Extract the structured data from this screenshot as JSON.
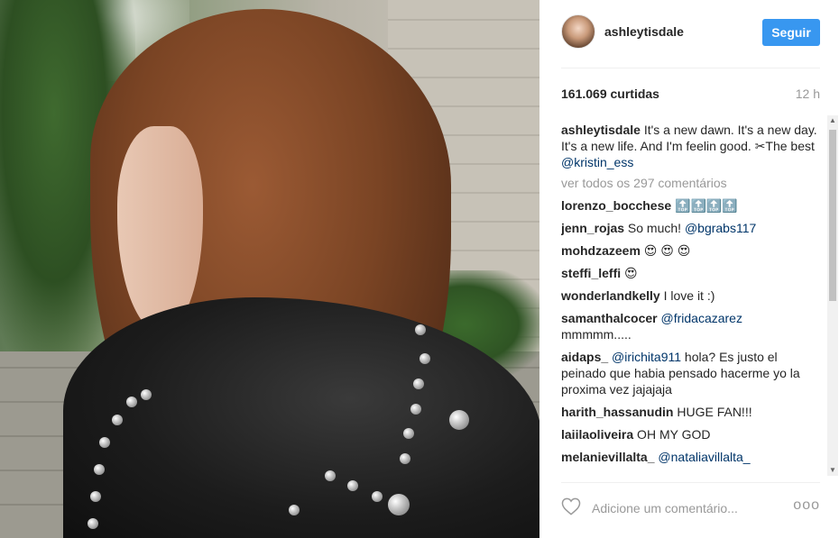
{
  "post": {
    "username": "ashleytisdale",
    "follow_label": "Seguir",
    "likes": "161.069 curtidas",
    "time": "12 h",
    "caption_user": "ashleytisdale",
    "caption_text": "It's a new dawn. It's a new day. It's a new life. And I'm feelin good. ✂The best ",
    "caption_mention": "@kristin_ess",
    "view_all": "ver todos os 297 comentários"
  },
  "comments": [
    {
      "user": "lorenzo_bocchese",
      "text": " 🔝🔝🔝🔝",
      "mention": ""
    },
    {
      "user": "jenn_rojas",
      "text": " So much! ",
      "mention": "@bgrabs117"
    },
    {
      "user": "mohdzazeem",
      "text": " 😍 😍 😍",
      "mention": ""
    },
    {
      "user": "steffi_leffi",
      "text": " 😍",
      "mention": ""
    },
    {
      "user": "wonderlandkelly",
      "text": " I love it :)",
      "mention": ""
    },
    {
      "user": "samanthalcocer",
      "text": " ",
      "mention": "@fridacazarez",
      "extra": "mmmmm..... "
    },
    {
      "user": "aidaps_",
      "text": " ",
      "mention": "@irichita911",
      "extra": " hola? Es justo el peinado que habia pensado hacerme yo la proxima vez jajajaja"
    },
    {
      "user": "harith_hassanudin",
      "text": " HUGE FAN!!!",
      "mention": ""
    },
    {
      "user": "laiilaoliveira",
      "text": " OH MY GOD",
      "mention": ""
    },
    {
      "user": "melanievillalta_",
      "text": " ",
      "mention": "@nataliavillalta_"
    }
  ],
  "footer": {
    "placeholder": "Adicione um comentário...",
    "more_label": "ooo"
  },
  "icons": {
    "heart": "heart-icon",
    "more": "more-options-icon"
  },
  "colors": {
    "accent": "#3897f0",
    "mention": "#003569",
    "muted": "#999999"
  }
}
